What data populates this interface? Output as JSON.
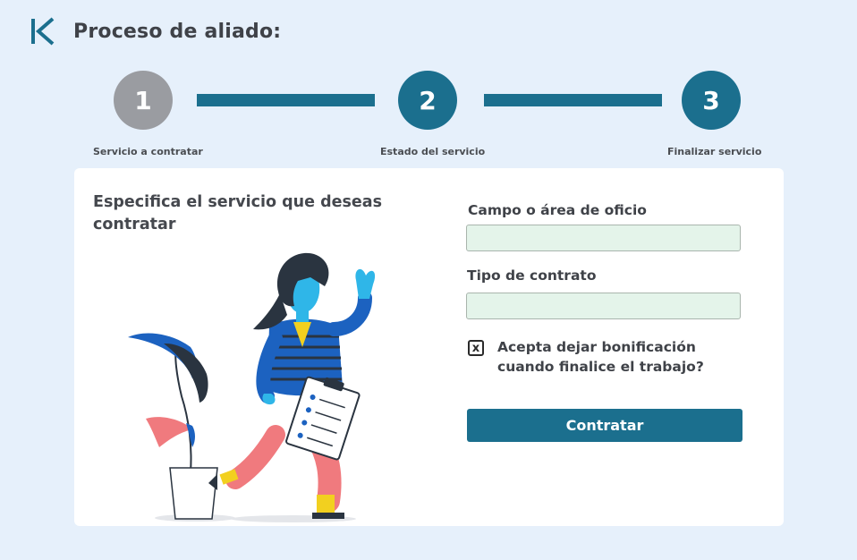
{
  "header": {
    "title": "Proceso de aliado:",
    "back_icon": "skip-back-icon",
    "accent_color": "#1b6f8e"
  },
  "stepper": {
    "steps": [
      {
        "number": "1",
        "label": "Servicio a contratar",
        "state": "inactive",
        "color": "#9a9ca1"
      },
      {
        "number": "2",
        "label": "Estado del servicio",
        "state": "active",
        "color": "#1b6f8e"
      },
      {
        "number": "3",
        "label": "Finalizar servicio",
        "state": "active",
        "color": "#1b6f8e"
      }
    ]
  },
  "form": {
    "heading": "Especifica el servicio que deseas contratar",
    "field_area_label": "Campo o área de oficio",
    "field_area_value": "",
    "field_contract_label": "Tipo de contrato",
    "field_contract_value": "",
    "checkbox_label": "Acepta dejar bonificación cuando finalice el trabajo?",
    "checkbox_state": "x",
    "submit_label": "Contratar"
  }
}
